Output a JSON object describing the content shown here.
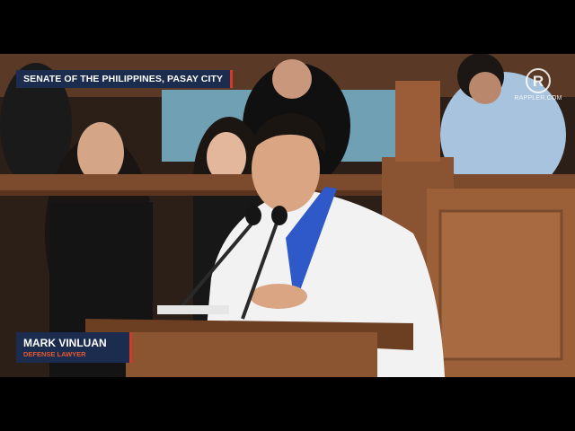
{
  "broadcast": {
    "location_tag": "SENATE OF THE PHILIPPINES, PASAY CITY",
    "speaker_name": "MARK VINLUAN",
    "speaker_role": "DEFENSE LAWYER",
    "logo_text": "RAPPLER.COM",
    "logo_glyph": "R"
  },
  "colors": {
    "tag_bg": "#1b2c4e",
    "accent": "#d23a2a",
    "role_text": "#e4572e"
  }
}
